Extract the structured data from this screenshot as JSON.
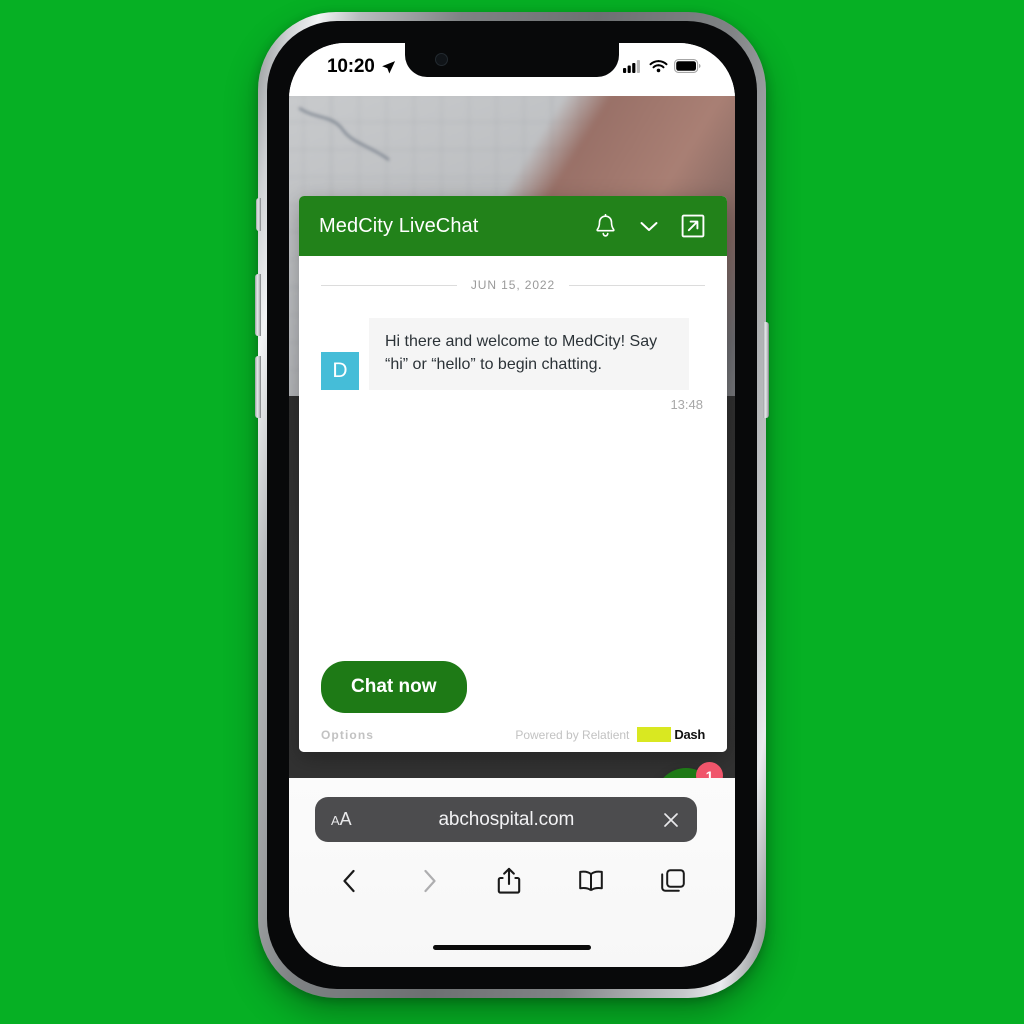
{
  "status_bar": {
    "time": "10:20",
    "location_icon": "location-arrow-icon",
    "signal_icon": "cellular-signal-icon",
    "wifi_icon": "wifi-icon",
    "battery_icon": "battery-icon"
  },
  "chat_widget": {
    "header": {
      "title": "MedCity LiveChat",
      "notifications_icon": "bell-icon",
      "minimize_icon": "chevron-down-icon",
      "expand_icon": "external-link-icon",
      "background_color": "#22821a"
    },
    "date_divider": "JUN 15, 2022",
    "messages": [
      {
        "avatar_initial": "D",
        "avatar_color": "#45bdd8",
        "text": "Hi there and welcome to MedCity! Say “hi” or “hello” to begin chatting.",
        "time": "13:48"
      }
    ],
    "cta_button": "Chat now",
    "options_link": "Options",
    "powered_by": "Powered by Relatient",
    "brand_logo_text": "Dash",
    "brand_logo_color": "#d9e821"
  },
  "fab": {
    "close_icon": "close-x-icon",
    "badge_count": "1",
    "color": "#1e7a16",
    "badge_color": "#f0556b"
  },
  "browser": {
    "text_size_small": "A",
    "text_size_large": "A",
    "text_size_name": "aa-text-size-icon",
    "url": "abchospital.com",
    "close_tab_icon": "close-x-icon",
    "toolbar": [
      {
        "name": "back-icon",
        "label": "Back"
      },
      {
        "name": "forward-icon",
        "label": "Forward"
      },
      {
        "name": "share-icon",
        "label": "Share"
      },
      {
        "name": "bookmarks-icon",
        "label": "Bookmarks"
      },
      {
        "name": "tabs-icon",
        "label": "Tabs"
      }
    ]
  }
}
